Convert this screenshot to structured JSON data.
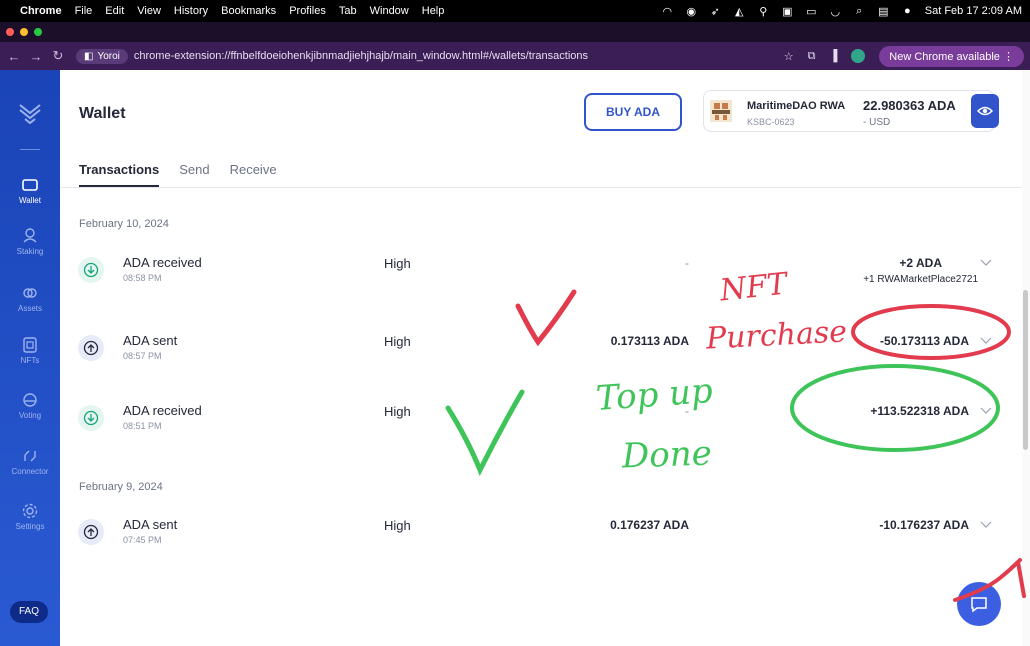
{
  "menubar": {
    "app": "Chrome",
    "items": [
      "File",
      "Edit",
      "View",
      "History",
      "Bookmarks",
      "Profiles",
      "Tab",
      "Window",
      "Help"
    ],
    "clock": "Sat Feb 17  2:09 AM"
  },
  "browser": {
    "tab_chip": "Yoroi",
    "url": "chrome-extension://ffnbelfdoeiohenkjibnmadjiehjhajb/main_window.html#/wallets/transactions",
    "update_label": "New Chrome available"
  },
  "sidebar": {
    "items": [
      {
        "label": "Wallet",
        "icon": "wallet-icon"
      },
      {
        "label": "Staking",
        "icon": "staking-icon"
      },
      {
        "label": "Assets",
        "icon": "assets-icon"
      },
      {
        "label": "NFTs",
        "icon": "nfts-icon"
      },
      {
        "label": "Voting",
        "icon": "voting-icon"
      },
      {
        "label": "Connector",
        "icon": "connector-icon"
      },
      {
        "label": "Settings",
        "icon": "settings-icon"
      }
    ],
    "faq": "FAQ"
  },
  "header": {
    "title": "Wallet",
    "buy_label": "BUY ADA",
    "wallet_name": "MaritimeDAO RWA",
    "wallet_plate": "KSBC-0623",
    "balance_ada": "22.980363 ADA",
    "balance_usd": "- USD"
  },
  "tabs": [
    "Transactions",
    "Send",
    "Receive"
  ],
  "groups": [
    {
      "date": "February 10, 2024",
      "transactions": [
        {
          "type": "ADA received",
          "time": "08:58 PM",
          "level": "High",
          "fee": "-",
          "amount": "+2 ADA",
          "amount_sub": "+1 RWAMarketPlace2721",
          "direction": "in"
        },
        {
          "type": "ADA sent",
          "time": "08:57 PM",
          "level": "High",
          "fee": "0.173113 ADA",
          "amount": "-50.173113 ADA",
          "amount_sub": "",
          "direction": "out"
        },
        {
          "type": "ADA received",
          "time": "08:51 PM",
          "level": "High",
          "fee": "-",
          "amount": "+113.522318 ADA",
          "amount_sub": "",
          "direction": "in"
        }
      ]
    },
    {
      "date": "February 9, 2024",
      "transactions": [
        {
          "type": "ADA sent",
          "time": "07:45 PM",
          "level": "High",
          "fee": "0.176237 ADA",
          "amount": "-10.176237 ADA",
          "amount_sub": "",
          "direction": "out"
        }
      ]
    }
  ],
  "annotations": {
    "nft_line1": "NFT",
    "nft_line2": "Purchase",
    "topup_line1": "Top up",
    "topup_line2": "Done"
  },
  "colors": {
    "accent": "#3154cb",
    "sidebar": "#1f4bc4",
    "annotation_red": "#e23b4e",
    "annotation_green": "#3fc45a"
  }
}
